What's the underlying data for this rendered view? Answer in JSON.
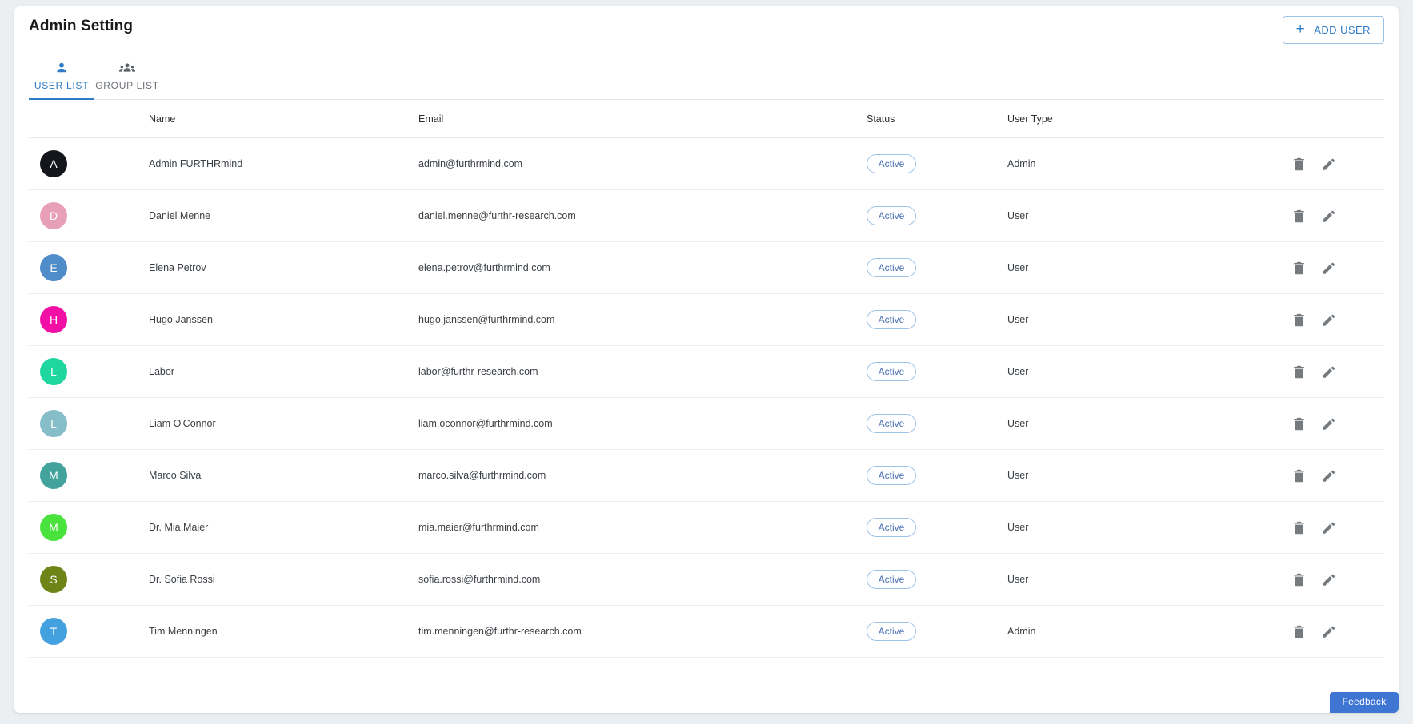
{
  "header": {
    "title": "Admin Setting",
    "add_user_label": "ADD USER",
    "add_user_icon": "plus-icon"
  },
  "tabs": [
    {
      "label": "USER LIST",
      "icon": "person-icon",
      "active": true
    },
    {
      "label": "GROUP LIST",
      "icon": "group-icon",
      "active": false
    }
  ],
  "table": {
    "columns": [
      "",
      "Name",
      "Email",
      "Status",
      "User Type",
      ""
    ],
    "rows": [
      {
        "initial": "A",
        "avatar_color": "#14161c",
        "name": "Admin FURTHRmind",
        "email": "admin@furthrmind.com",
        "status": "Active",
        "user_type": "Admin"
      },
      {
        "initial": "D",
        "avatar_color": "#e8a0b8",
        "name": "Daniel Menne",
        "email": "daniel.menne@furthr-research.com",
        "status": "Active",
        "user_type": "User"
      },
      {
        "initial": "E",
        "avatar_color": "#4f8cc9",
        "name": "Elena Petrov",
        "email": "elena.petrov@furthrmind.com",
        "status": "Active",
        "user_type": "User"
      },
      {
        "initial": "H",
        "avatar_color": "#f20fa5",
        "name": "Hugo Janssen",
        "email": "hugo.janssen@furthrmind.com",
        "status": "Active",
        "user_type": "User"
      },
      {
        "initial": "L",
        "avatar_color": "#1fd6a0",
        "name": "Labor",
        "email": "labor@furthr-research.com",
        "status": "Active",
        "user_type": "User"
      },
      {
        "initial": "L",
        "avatar_color": "#85bdc9",
        "name": "Liam O'Connor",
        "email": "liam.oconnor@furthrmind.com",
        "status": "Active",
        "user_type": "User"
      },
      {
        "initial": "M",
        "avatar_color": "#41a39b",
        "name": "Marco Silva",
        "email": "marco.silva@furthrmind.com",
        "status": "Active",
        "user_type": "User"
      },
      {
        "initial": "M",
        "avatar_color": "#4ae23c",
        "name": "Dr. Mia Maier",
        "email": "mia.maier@furthrmind.com",
        "status": "Active",
        "user_type": "User"
      },
      {
        "initial": "S",
        "avatar_color": "#6e8416",
        "name": "Dr. Sofia Rossi",
        "email": "sofia.rossi@furthrmind.com",
        "status": "Active",
        "user_type": "User"
      },
      {
        "initial": "T",
        "avatar_color": "#43a1e0",
        "name": "Tim Menningen",
        "email": "tim.menningen@furthr-research.com",
        "status": "Active",
        "user_type": "Admin"
      }
    ],
    "row_actions": {
      "delete_icon": "trash-icon",
      "edit_icon": "pencil-icon"
    }
  },
  "feedback": {
    "label": "Feedback"
  },
  "colors": {
    "accent": "#2f7cc4",
    "page_bg": "#eceff1",
    "card_bg": "#ffffff",
    "row_border": "#ececee",
    "feedback_bg": "#3f76d4"
  }
}
